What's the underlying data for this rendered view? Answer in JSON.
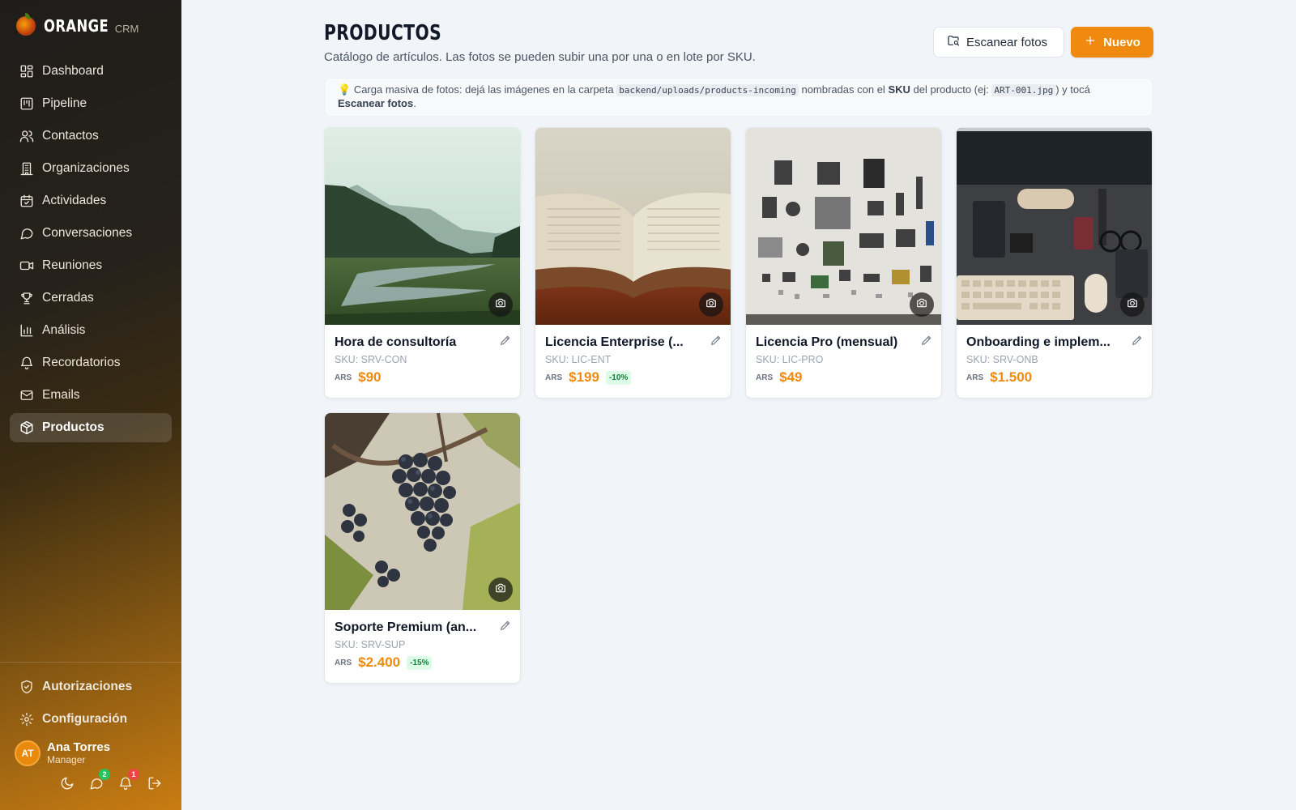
{
  "brand": {
    "name": "ORANGE",
    "sub": "CRM"
  },
  "sidebar": {
    "items": [
      {
        "label": "Dashboard",
        "icon": "dashboard-icon"
      },
      {
        "label": "Pipeline",
        "icon": "kanban-icon"
      },
      {
        "label": "Contactos",
        "icon": "users-icon"
      },
      {
        "label": "Organizaciones",
        "icon": "building-icon"
      },
      {
        "label": "Actividades",
        "icon": "calendar-icon"
      },
      {
        "label": "Conversaciones",
        "icon": "chat-icon"
      },
      {
        "label": "Reuniones",
        "icon": "video-icon"
      },
      {
        "label": "Cerradas",
        "icon": "trophy-icon"
      },
      {
        "label": "Análisis",
        "icon": "bar-chart-icon"
      },
      {
        "label": "Recordatorios",
        "icon": "bell-icon"
      },
      {
        "label": "Emails",
        "icon": "mail-icon"
      },
      {
        "label": "Productos",
        "icon": "box-icon",
        "active": true
      }
    ],
    "bottom": [
      {
        "label": "Autorizaciones",
        "icon": "shield-icon"
      },
      {
        "label": "Configuración",
        "icon": "gear-icon"
      }
    ],
    "user": {
      "initials": "AT",
      "name": "Ana Torres",
      "role": "Manager"
    },
    "actions": {
      "chat_badge": "2",
      "notif_badge": "1"
    }
  },
  "header": {
    "title": "PRODUCTOS",
    "subtitle": "Catálogo de artículos. Las fotos se pueden subir una por una o en lote por SKU.",
    "scan_label": "Escanear fotos",
    "new_label": "Nuevo"
  },
  "hint": {
    "icon": "💡",
    "part1": "Carga masiva de fotos: dejá las imágenes en la carpeta",
    "folder": "backend/uploads/products-incoming",
    "part2": "nombradas con el",
    "sku_word": "SKU",
    "part3": "del producto (ej:",
    "example": "ART-001.jpg",
    "part4": ") y tocá",
    "action": "Escanear fotos",
    "end": "."
  },
  "products": [
    {
      "name": "Hora de consultoría",
      "sku": "SKU: SRV-CON",
      "currency": "ARS",
      "price": "$90",
      "discount": "",
      "image": "landscape-lake"
    },
    {
      "name": "Licencia Enterprise (...",
      "sku": "SKU: LIC-ENT",
      "currency": "ARS",
      "price": "$199",
      "discount": "-10%",
      "image": "open-book"
    },
    {
      "name": "Licencia Pro (mensual)",
      "sku": "SKU: LIC-PRO",
      "currency": "ARS",
      "price": "$49",
      "discount": "",
      "image": "electronics-parts"
    },
    {
      "name": "Onboarding e implem...",
      "sku": "SKU: SRV-ONB",
      "currency": "ARS",
      "price": "$1.500",
      "discount": "",
      "image": "desk-workspace"
    },
    {
      "name": "Soporte Premium (an...",
      "sku": "SKU: SRV-SUP",
      "currency": "ARS",
      "price": "$2.400",
      "discount": "-15%",
      "image": "grapes"
    }
  ],
  "colors": {
    "accent": "#f0890f",
    "discount_bg": "#dcfce7",
    "discount_text": "#15803d"
  }
}
